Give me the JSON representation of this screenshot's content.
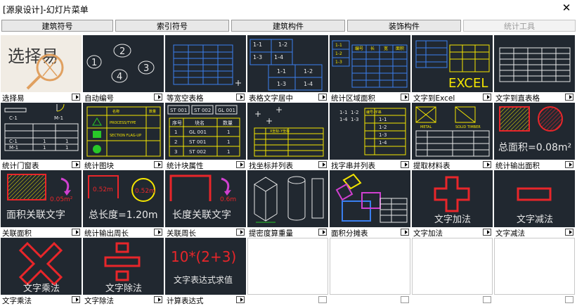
{
  "window": {
    "title": "[源泉设计]-幻灯片菜单",
    "close_glyph": "✕"
  },
  "tabs": [
    {
      "label": "建筑符号",
      "enabled": true
    },
    {
      "label": "索引符号",
      "enabled": true
    },
    {
      "label": "建筑构件",
      "enabled": true
    },
    {
      "label": "装饰构件",
      "enabled": true
    },
    {
      "label": "统计工具",
      "enabled": false
    }
  ],
  "slides": [
    {
      "label": "选择易",
      "icon": "magnifier-select-icon"
    },
    {
      "label": "自动编号",
      "icon": "auto-number-icon"
    },
    {
      "label": "等宽空表格",
      "icon": "empty-table-icon"
    },
    {
      "label": "表格文字居中",
      "icon": "table-text-center-icon"
    },
    {
      "label": "统计区域面积",
      "icon": "area-table-icon"
    },
    {
      "label": "文字到Excel",
      "icon": "text-to-excel-icon"
    },
    {
      "label": "文字到直表格",
      "icon": "text-to-table-icon"
    },
    {
      "label": "统计门窗表",
      "icon": "door-window-table-icon"
    },
    {
      "label": "统计图块",
      "icon": "block-count-icon"
    },
    {
      "label": "统计块属性",
      "icon": "block-attribute-icon"
    },
    {
      "label": "找坐标并列表",
      "icon": "coordinate-list-icon"
    },
    {
      "label": "找字串并列表",
      "icon": "string-list-icon"
    },
    {
      "label": "提取材料表",
      "icon": "material-table-icon"
    },
    {
      "label": "统计输出面积",
      "icon": "area-output-icon"
    },
    {
      "label": "关联面积",
      "icon": "linked-area-icon"
    },
    {
      "label": "统计输出周长",
      "icon": "perimeter-output-icon"
    },
    {
      "label": "关联周长",
      "icon": "linked-length-icon"
    },
    {
      "label": "提密度算重量",
      "icon": "density-weight-icon"
    },
    {
      "label": "面积分摊表",
      "icon": "area-share-icon"
    },
    {
      "label": "文字加法",
      "icon": "plus-icon"
    },
    {
      "label": "文字减法",
      "icon": "minus-icon"
    },
    {
      "label": "文字乘法",
      "icon": "multiply-icon"
    },
    {
      "label": "文字除法",
      "icon": "divide-icon"
    },
    {
      "label": "计算表达式",
      "icon": "expression-icon"
    },
    {
      "label": "",
      "icon": ""
    },
    {
      "label": "",
      "icon": ""
    },
    {
      "label": "",
      "icon": ""
    },
    {
      "label": "",
      "icon": ""
    }
  ],
  "thumb_text": {
    "select": "选择易",
    "num1": "1",
    "num2": "2",
    "num3": "3",
    "num4": "4",
    "tbl_1_1": "1-1",
    "tbl_1_2": "1-2",
    "tbl_1_3": "1-3",
    "tbl_1_4": "1-4",
    "hdr_no": "编号",
    "hdr_len": "长",
    "hdr_wid": "宽",
    "hdr_area": "面积",
    "excel": "EXCEL",
    "win_c1": "C-1",
    "win_m1": "M-1",
    "hdr_name": "名称",
    "hdr_qty": "数量",
    "flag_a": "PROCESS/TYPE",
    "flag_b": "SECTION FLAG-UP",
    "st001": "ST 001",
    "st002": "ST 002",
    "gl001": "GL 001",
    "seq": "序号",
    "blk": "块名",
    "qty": "数量",
    "v1": "1",
    "v2": "2",
    "v3": "3",
    "plus": "+",
    "coord_hdr": "X坐标-Y坐标",
    "str_hdr": "编号-字串",
    "metal": "METAL",
    "solid": "SOLID TIMBER",
    "total_area": "总面积=0.08m²",
    "area_val": "0.05m²",
    "linked_text": "面积关联文字",
    "length_val": "0.52m",
    "total_len": "总长度=1.20m",
    "len_val": "0.6m",
    "linked_len": "长度关联文字",
    "add": "文字加法",
    "sub": "文字减法",
    "mul": "文字乘法",
    "div": "文字除法",
    "expr": "10*(2+3)",
    "expr_cap": "文字表达式求值"
  },
  "colors": {
    "thumb_bg": "#212830",
    "cad_white": "#e8e8e8",
    "cad_yellow": "#f5e600",
    "cad_red": "#e8262a",
    "cad_magenta": "#d040d0",
    "cad_blue": "#3a7ff0",
    "cad_green": "#28c828",
    "cad_cyan": "#39d6e8"
  }
}
